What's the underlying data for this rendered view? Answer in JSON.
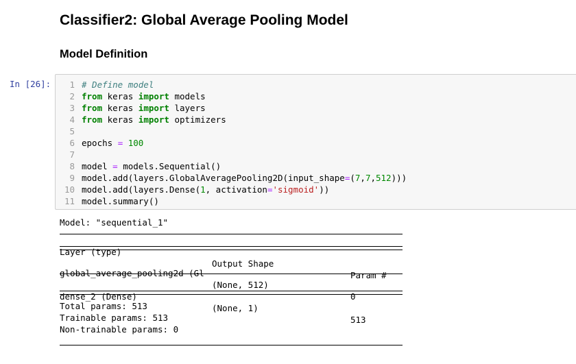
{
  "notebook": {
    "heading": "Classifier2: Global Average Pooling Model",
    "subheading": "Model Definition",
    "cell": {
      "prompt": "In [26]:",
      "lines": [
        {
          "n": "1",
          "tokens": [
            {
              "t": "# Define model",
              "k": "comment"
            }
          ]
        },
        {
          "n": "2",
          "tokens": [
            {
              "t": "from",
              "k": "kw"
            },
            {
              "t": " keras ",
              "k": "plain"
            },
            {
              "t": "import",
              "k": "kw"
            },
            {
              "t": " models",
              "k": "plain"
            }
          ]
        },
        {
          "n": "3",
          "tokens": [
            {
              "t": "from",
              "k": "kw"
            },
            {
              "t": " keras ",
              "k": "plain"
            },
            {
              "t": "import",
              "k": "kw"
            },
            {
              "t": " layers",
              "k": "plain"
            }
          ]
        },
        {
          "n": "4",
          "tokens": [
            {
              "t": "from",
              "k": "kw"
            },
            {
              "t": " keras ",
              "k": "plain"
            },
            {
              "t": "import",
              "k": "kw"
            },
            {
              "t": " optimizers",
              "k": "plain"
            }
          ]
        },
        {
          "n": "5",
          "tokens": []
        },
        {
          "n": "6",
          "tokens": [
            {
              "t": "epochs ",
              "k": "plain"
            },
            {
              "t": "=",
              "k": "op"
            },
            {
              "t": " ",
              "k": "plain"
            },
            {
              "t": "100",
              "k": "num"
            }
          ]
        },
        {
          "n": "7",
          "tokens": []
        },
        {
          "n": "8",
          "tokens": [
            {
              "t": "model ",
              "k": "plain"
            },
            {
              "t": "=",
              "k": "op"
            },
            {
              "t": " models.Sequential()",
              "k": "plain"
            }
          ]
        },
        {
          "n": "9",
          "tokens": [
            {
              "t": "model.add(layers.GlobalAveragePooling2D(input_shape",
              "k": "plain"
            },
            {
              "t": "=",
              "k": "op"
            },
            {
              "t": "(",
              "k": "plain"
            },
            {
              "t": "7",
              "k": "num"
            },
            {
              "t": ",",
              "k": "plain"
            },
            {
              "t": "7",
              "k": "num"
            },
            {
              "t": ",",
              "k": "plain"
            },
            {
              "t": "512",
              "k": "num"
            },
            {
              "t": ")))",
              "k": "plain"
            }
          ]
        },
        {
          "n": "10",
          "tokens": [
            {
              "t": "model.add(layers.Dense(",
              "k": "plain"
            },
            {
              "t": "1",
              "k": "num"
            },
            {
              "t": ", activation",
              "k": "plain"
            },
            {
              "t": "=",
              "k": "op"
            },
            {
              "t": "'sigmoid'",
              "k": "str"
            },
            {
              "t": "))",
              "k": "plain"
            }
          ]
        },
        {
          "n": "11",
          "tokens": [
            {
              "t": "model.summary()",
              "k": "plain"
            }
          ]
        }
      ]
    },
    "output": {
      "model_line": "Model: \"sequential_1\"",
      "headers": {
        "layer": "Layer (type)",
        "shape": "Output Shape",
        "params": "Param #"
      },
      "rows": [
        {
          "layer": "global_average_pooling2d (Gl",
          "shape": "(None, 512)",
          "params": "0"
        },
        {
          "layer": "dense_2 (Dense)",
          "shape": "(None, 1)",
          "params": "513"
        }
      ],
      "total": "Total params: 513",
      "trainable": "Trainable params: 513",
      "non_trainable": "Non-trainable params: 0"
    }
  }
}
